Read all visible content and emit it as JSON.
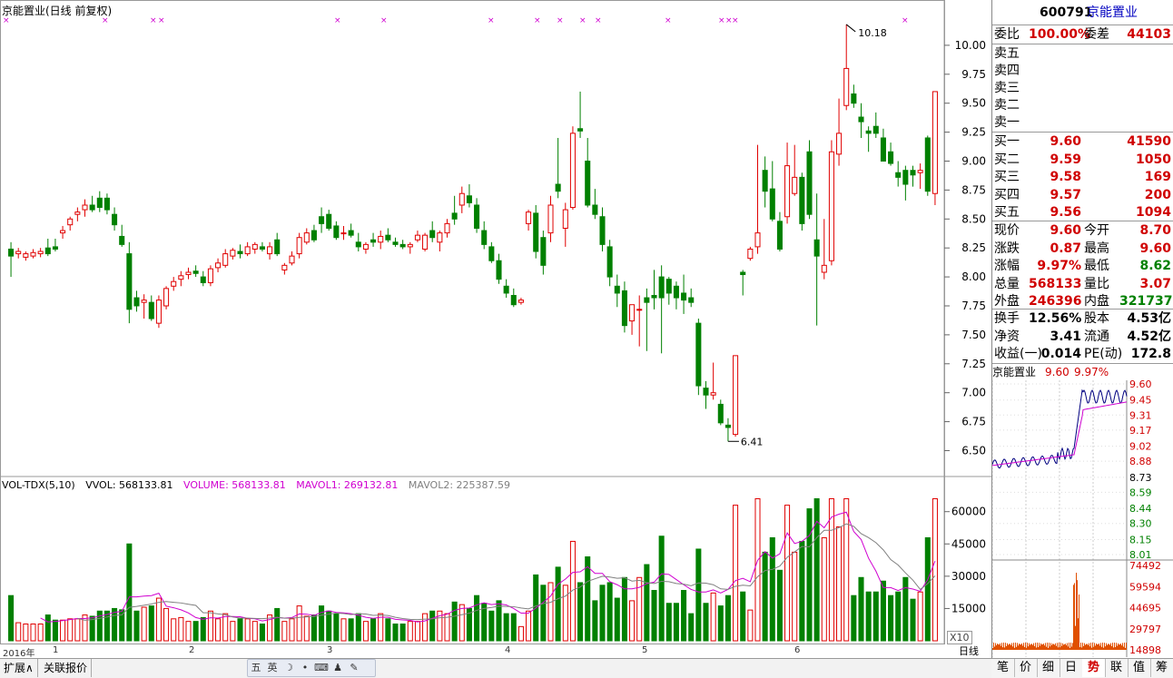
{
  "chart_title": "京能置业(日线 前复权)",
  "price_axis": [
    "10.00",
    "9.75",
    "9.50",
    "9.25",
    "9.00",
    "8.75",
    "8.50",
    "8.25",
    "8.00",
    "7.75",
    "7.50",
    "7.25",
    "7.00",
    "6.75",
    "6.50"
  ],
  "annotations": {
    "high": "10.18",
    "low": "6.41"
  },
  "volume_legend": {
    "vol_tdx": "VOL-TDX(5,10)",
    "vvol": "VVOL: 568133.81",
    "volume": "VOLUME: 568133.81",
    "mavol1": "MAVOL1: 269132.81",
    "mavol2": "MAVOL2: 225387.59"
  },
  "volume_axis": [
    "60000",
    "45000",
    "30000",
    "15000"
  ],
  "volume_unit": "X10",
  "date_axis": {
    "year": "2016年",
    "months": [
      "1",
      "2",
      "3",
      "4",
      "5",
      "6"
    ]
  },
  "period_label": "日线",
  "bottom_tabs": [
    "扩展∧",
    "关联报价"
  ],
  "tool_icons": [
    "五",
    "英",
    "☽",
    "•",
    "⌨",
    "♟",
    "✎"
  ],
  "right_tabs": [
    "笔",
    "价",
    "细",
    "日",
    "势",
    "联",
    "值",
    "筹"
  ],
  "colors": {
    "up": "#e00000",
    "down": "#008000",
    "ma1": "#d000d0",
    "ma2": "#808080",
    "accent_blue": "#0000c0"
  },
  "stock": {
    "code": "600791",
    "name": "京能置业"
  },
  "order_ratio": {
    "label": "委比",
    "value": "100.00%",
    "diff_label": "委差",
    "diff_value": "44103"
  },
  "sell_orders": [
    {
      "label": "卖五",
      "price": "",
      "volume": ""
    },
    {
      "label": "卖四",
      "price": "",
      "volume": ""
    },
    {
      "label": "卖三",
      "price": "",
      "volume": ""
    },
    {
      "label": "卖二",
      "price": "",
      "volume": ""
    },
    {
      "label": "卖一",
      "price": "",
      "volume": ""
    }
  ],
  "buy_orders": [
    {
      "label": "买一",
      "price": "9.60",
      "volume": "41590"
    },
    {
      "label": "买二",
      "price": "9.59",
      "volume": "1050"
    },
    {
      "label": "买三",
      "price": "9.58",
      "volume": "169"
    },
    {
      "label": "买四",
      "price": "9.57",
      "volume": "200"
    },
    {
      "label": "买五",
      "price": "9.56",
      "volume": "1094"
    }
  ],
  "quote": [
    {
      "l1": "现价",
      "v1": "9.60",
      "l2": "今开",
      "v2": "8.70"
    },
    {
      "l1": "涨跌",
      "v1": "0.87",
      "l2": "最高",
      "v2": "9.60"
    },
    {
      "l1": "涨幅",
      "v1": "9.97%",
      "l2": "最低",
      "v2": "8.62"
    },
    {
      "l1": "总量",
      "v1": "568133",
      "l2": "量比",
      "v2": "3.07"
    },
    {
      "l1": "外盘",
      "v1": "246396",
      "l2": "内盘",
      "v2": "321737"
    }
  ],
  "fundamentals": [
    {
      "l1": "换手",
      "v1": "12.56%",
      "l2": "股本",
      "v2": "4.53亿"
    },
    {
      "l1": "净资",
      "v1": "3.41",
      "l2": "流通",
      "v2": "4.52亿"
    },
    {
      "l1": "收益(一)",
      "v1": "0.014",
      "l2": "PE(动)",
      "v2": "172.8"
    }
  ],
  "mini_chart": {
    "name": "京能置业",
    "price": "9.60",
    "pct": "9.97%",
    "price_axis": [
      "9.60",
      "9.45",
      "9.31",
      "9.17",
      "9.02",
      "8.88",
      "8.73",
      "8.59",
      "8.44",
      "8.30",
      "8.15",
      "8.01"
    ],
    "volume_axis": [
      "74492",
      "59594",
      "44695",
      "29797",
      "14898"
    ]
  },
  "chart_data": {
    "type": "candlestick",
    "ylim": [
      6.3,
      10.25
    ],
    "candles": [
      [
        8.24,
        8.3,
        8.0,
        8.18
      ],
      [
        8.2,
        8.25,
        8.16,
        8.22
      ],
      [
        8.17,
        8.22,
        8.14,
        8.2
      ],
      [
        8.18,
        8.24,
        8.16,
        8.21
      ],
      [
        8.2,
        8.25,
        8.17,
        8.22
      ],
      [
        8.25,
        8.33,
        8.18,
        8.2
      ],
      [
        8.26,
        8.33,
        8.22,
        8.24
      ],
      [
        8.38,
        8.44,
        8.33,
        8.4
      ],
      [
        8.45,
        8.52,
        8.4,
        8.5
      ],
      [
        8.54,
        8.6,
        8.48,
        8.56
      ],
      [
        8.58,
        8.67,
        8.52,
        8.62
      ],
      [
        8.62,
        8.7,
        8.56,
        8.58
      ],
      [
        8.68,
        8.74,
        8.56,
        8.6
      ],
      [
        8.68,
        8.72,
        8.54,
        8.58
      ],
      [
        8.54,
        8.6,
        8.4,
        8.45
      ],
      [
        8.35,
        8.45,
        8.26,
        8.28
      ],
      [
        8.2,
        8.3,
        7.6,
        7.72
      ],
      [
        7.82,
        7.88,
        7.7,
        7.75
      ],
      [
        7.78,
        7.85,
        7.64,
        7.8
      ],
      [
        7.78,
        7.84,
        7.62,
        7.64
      ],
      [
        7.6,
        7.84,
        7.56,
        7.8
      ],
      [
        7.75,
        7.92,
        7.72,
        7.9
      ],
      [
        7.92,
        8.0,
        7.88,
        7.96
      ],
      [
        7.98,
        8.05,
        7.92,
        8.01
      ],
      [
        8.02,
        8.08,
        7.98,
        8.04
      ],
      [
        8.05,
        8.1,
        8.0,
        8.03
      ],
      [
        8.0,
        8.05,
        7.92,
        7.95
      ],
      [
        7.95,
        8.1,
        7.92,
        8.07
      ],
      [
        8.08,
        8.16,
        8.04,
        8.12
      ],
      [
        8.1,
        8.24,
        8.08,
        8.2
      ],
      [
        8.18,
        8.25,
        8.15,
        8.23
      ],
      [
        8.22,
        8.28,
        8.16,
        8.2
      ],
      [
        8.2,
        8.3,
        8.18,
        8.26
      ],
      [
        8.24,
        8.3,
        8.2,
        8.28
      ],
      [
        8.26,
        8.3,
        8.22,
        8.24
      ],
      [
        8.2,
        8.3,
        8.15,
        8.26
      ],
      [
        8.32,
        8.38,
        8.18,
        8.2
      ],
      [
        8.06,
        8.12,
        8.02,
        8.1
      ],
      [
        8.12,
        8.22,
        8.1,
        8.18
      ],
      [
        8.2,
        8.38,
        8.16,
        8.34
      ],
      [
        8.3,
        8.42,
        8.28,
        8.38
      ],
      [
        8.4,
        8.45,
        8.3,
        8.32
      ],
      [
        8.52,
        8.6,
        8.38,
        8.46
      ],
      [
        8.54,
        8.58,
        8.4,
        8.42
      ],
      [
        8.44,
        8.48,
        8.32,
        8.34
      ],
      [
        8.38,
        8.44,
        8.32,
        8.38
      ],
      [
        8.4,
        8.46,
        8.34,
        8.36
      ],
      [
        8.3,
        8.38,
        8.22,
        8.26
      ],
      [
        8.24,
        8.3,
        8.2,
        8.28
      ],
      [
        8.32,
        8.38,
        8.26,
        8.3
      ],
      [
        8.3,
        8.4,
        8.24,
        8.35
      ],
      [
        8.36,
        8.42,
        8.3,
        8.32
      ],
      [
        8.3,
        8.34,
        8.26,
        8.28
      ],
      [
        8.28,
        8.32,
        8.24,
        8.26
      ],
      [
        8.26,
        8.3,
        8.2,
        8.28
      ],
      [
        8.32,
        8.4,
        8.3,
        8.36
      ],
      [
        8.24,
        8.38,
        8.22,
        8.36
      ],
      [
        8.4,
        8.48,
        8.3,
        8.34
      ],
      [
        8.3,
        8.4,
        8.22,
        8.38
      ],
      [
        8.38,
        8.5,
        8.34,
        8.46
      ],
      [
        8.55,
        8.7,
        8.45,
        8.5
      ],
      [
        8.62,
        8.78,
        8.55,
        8.72
      ],
      [
        8.7,
        8.8,
        8.6,
        8.64
      ],
      [
        8.62,
        8.68,
        8.38,
        8.42
      ],
      [
        8.4,
        8.48,
        8.24,
        8.28
      ],
      [
        8.26,
        8.3,
        8.12,
        8.14
      ],
      [
        8.14,
        8.2,
        7.94,
        7.98
      ],
      [
        7.92,
        7.98,
        7.82,
        7.86
      ],
      [
        7.84,
        7.9,
        7.74,
        7.76
      ],
      [
        7.78,
        7.82,
        7.76,
        7.8
      ],
      [
        8.46,
        8.58,
        8.4,
        8.56
      ],
      [
        8.55,
        8.62,
        8.16,
        8.22
      ],
      [
        8.34,
        8.4,
        8.02,
        8.1
      ],
      [
        8.38,
        8.7,
        8.3,
        8.62
      ],
      [
        8.8,
        9.2,
        8.68,
        8.74
      ],
      [
        8.42,
        8.64,
        8.26,
        8.58
      ],
      [
        8.6,
        9.3,
        8.58,
        9.24
      ],
      [
        9.28,
        9.6,
        9.2,
        9.26
      ],
      [
        9.0,
        9.2,
        8.6,
        8.62
      ],
      [
        8.62,
        8.76,
        8.5,
        8.54
      ],
      [
        8.52,
        8.6,
        8.22,
        8.28
      ],
      [
        8.26,
        8.32,
        7.92,
        8.0
      ],
      [
        7.92,
        8.02,
        7.74,
        7.86
      ],
      [
        7.88,
        7.96,
        7.52,
        7.58
      ],
      [
        7.62,
        7.76,
        7.5,
        7.76
      ],
      [
        7.72,
        7.84,
        7.4,
        7.72
      ],
      [
        7.82,
        7.9,
        7.36,
        7.78
      ],
      [
        7.84,
        8.06,
        7.72,
        7.82
      ],
      [
        8.0,
        8.1,
        7.34,
        7.82
      ],
      [
        7.98,
        8.0,
        7.76,
        7.86
      ],
      [
        7.92,
        7.96,
        7.72,
        7.82
      ],
      [
        7.86,
        8.02,
        7.68,
        7.8
      ],
      [
        7.82,
        7.9,
        7.74,
        7.78
      ],
      [
        7.6,
        7.64,
        6.98,
        7.06
      ],
      [
        7.04,
        7.1,
        6.86,
        6.98
      ],
      [
        6.98,
        7.26,
        6.94,
        7.0
      ],
      [
        6.9,
        6.94,
        6.72,
        6.74
      ],
      [
        6.72,
        6.78,
        6.58,
        6.7
      ],
      [
        6.64,
        7.32,
        6.62,
        7.32
      ],
      [
        8.04,
        8.06,
        7.84,
        8.02
      ],
      [
        8.16,
        8.26,
        8.14,
        8.24
      ],
      [
        8.26,
        9.14,
        8.2,
        8.38
      ],
      [
        8.92,
        9.04,
        8.6,
        8.74
      ],
      [
        8.76,
        9.0,
        8.48,
        8.5
      ],
      [
        8.48,
        8.56,
        8.22,
        8.24
      ],
      [
        8.52,
        9.16,
        8.46,
        8.96
      ],
      [
        8.72,
        9.14,
        8.7,
        8.86
      ],
      [
        8.86,
        8.9,
        8.4,
        8.46
      ],
      [
        9.08,
        9.18,
        8.5,
        8.54
      ],
      [
        8.32,
        8.72,
        7.58,
        8.18
      ],
      [
        8.04,
        8.5,
        7.98,
        8.1
      ],
      [
        8.14,
        9.18,
        8.1,
        9.08
      ],
      [
        9.06,
        9.54,
        8.96,
        9.24
      ],
      [
        9.48,
        10.18,
        9.44,
        9.8
      ],
      [
        9.58,
        9.66,
        9.46,
        9.5
      ],
      [
        9.38,
        9.5,
        9.2,
        9.34
      ],
      [
        9.26,
        9.3,
        9.08,
        9.24
      ],
      [
        9.3,
        9.42,
        9.2,
        9.24
      ],
      [
        9.2,
        9.28,
        9.0,
        9.0
      ],
      [
        9.08,
        9.16,
        8.96,
        8.98
      ],
      [
        8.9,
        9.0,
        8.78,
        8.86
      ],
      [
        8.92,
        8.96,
        8.66,
        8.8
      ],
      [
        8.92,
        8.96,
        8.78,
        8.88
      ],
      [
        8.9,
        8.98,
        8.76,
        8.92
      ],
      [
        9.2,
        9.22,
        8.7,
        8.74
      ],
      [
        8.72,
        9.6,
        8.62,
        9.6
      ]
    ],
    "volumes": [],
    "ma1_color": "#d000d0",
    "ma2_color": "#808080"
  }
}
